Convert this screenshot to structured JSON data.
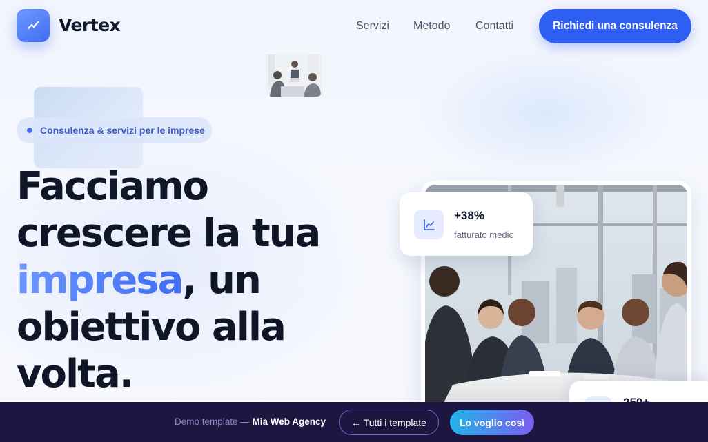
{
  "header": {
    "brand": "Vertex",
    "logo_icon": "trend-line-icon",
    "nav": [
      "Servizi",
      "Metodo",
      "Contatti"
    ],
    "cta_label": "Richiedi una consulenza"
  },
  "hero": {
    "badge": "Consulenza & servizi per le imprese",
    "headline": {
      "line1": "Facciamo",
      "line2": "crescere la tua",
      "accent": "impresa",
      "line3_rest": ", un",
      "line4": "obiettivo alla",
      "line5": "volta."
    }
  },
  "stats": {
    "primary": {
      "value": "+38%",
      "label": "fatturato medio",
      "icon": "chart-line-icon"
    },
    "secondary": {
      "value": "250+"
    }
  },
  "demo_bar": {
    "prefix": "Demo template — ",
    "agency": "Mia Web Agency",
    "back_label": "← Tutti i template",
    "cta_label": "Lo voglio così"
  },
  "colors": {
    "primary": "#2f5ef2",
    "accent_gradient_start": "#6b95ff",
    "text_dark": "#0f1627",
    "demo_bar_bg": "#1c1640"
  }
}
